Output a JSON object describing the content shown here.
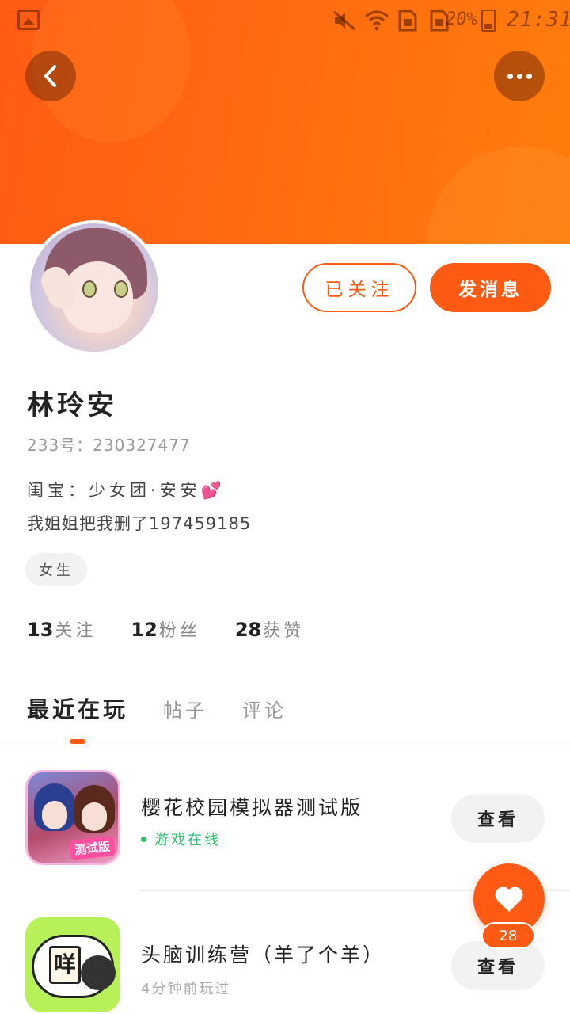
{
  "status_bar": {
    "battery": "20%",
    "time": "21:31",
    "icons": [
      "image-icon",
      "mute-icon",
      "wifi-icon",
      "sim1-icon",
      "sim2-icon",
      "battery-charging-icon"
    ]
  },
  "header": {
    "back_icon": "chevron-left-icon",
    "more_icon": "more-horizontal-icon",
    "gradient_colors": [
      "#ff5a14",
      "#ff7d0c"
    ]
  },
  "profile": {
    "follow_button": "已关注",
    "message_button": "发消息",
    "name": "林玲安",
    "uid": "233号：230327477",
    "bio_line1": "闺宝：少女团·安安💕",
    "bio_line2": "我姐姐把我删了197459185",
    "gender_tag": "女生",
    "stats": [
      {
        "num": "13",
        "label": "关注"
      },
      {
        "num": "12",
        "label": "粉丝"
      },
      {
        "num": "28",
        "label": "获赞"
      }
    ]
  },
  "tabs": [
    {
      "label": "最近在玩",
      "active": true
    },
    {
      "label": "帖子",
      "active": false
    },
    {
      "label": "评论",
      "active": false
    }
  ],
  "games": [
    {
      "title": "樱花校园模拟器测试版",
      "status": "游戏在线",
      "icon_badge": "测试版",
      "view_label": "查看"
    },
    {
      "title": "头脑训练营（羊了个羊）",
      "status": "4分钟前玩过",
      "icon_tile": "咩",
      "view_label": "查看"
    }
  ],
  "like_fab": {
    "icon": "heart-icon",
    "count": "28"
  },
  "colors": {
    "accent": "#ff5a14",
    "online_green": "#2cc36b"
  }
}
